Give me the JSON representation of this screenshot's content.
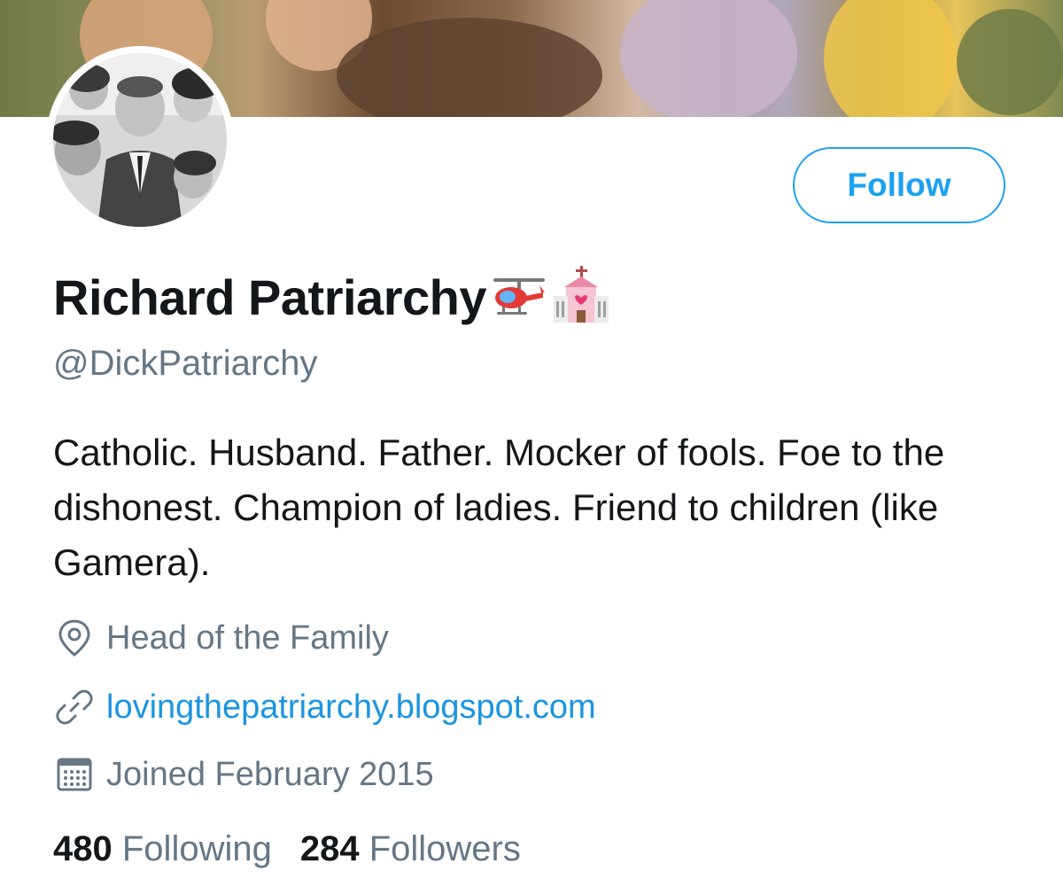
{
  "profile": {
    "display_name": "Richard Patriarchy",
    "handle": "@DickPatriarchy",
    "bio": "Catholic. Husband. Father. Mocker of fools. Foe to the dishonest. Champion of ladies. Friend to children (like Gamera).",
    "name_emojis": [
      "helicopter-emoji",
      "wedding-chapel-emoji"
    ],
    "location": "Head of the Family",
    "website": "lovingthepatriarchy.blogspot.com",
    "joined": "Joined February 2015"
  },
  "actions": {
    "follow_label": "Follow"
  },
  "stats": {
    "following_count": "480",
    "following_label": "Following",
    "followers_count": "284",
    "followers_label": "Followers"
  },
  "icons": {
    "location": "location-pin-icon",
    "link": "link-icon",
    "joined": "calendar-icon"
  },
  "colors": {
    "accent": "#1da1f2",
    "link": "#1b95e0",
    "secondary_text": "#657786",
    "primary_text": "#14171a"
  }
}
